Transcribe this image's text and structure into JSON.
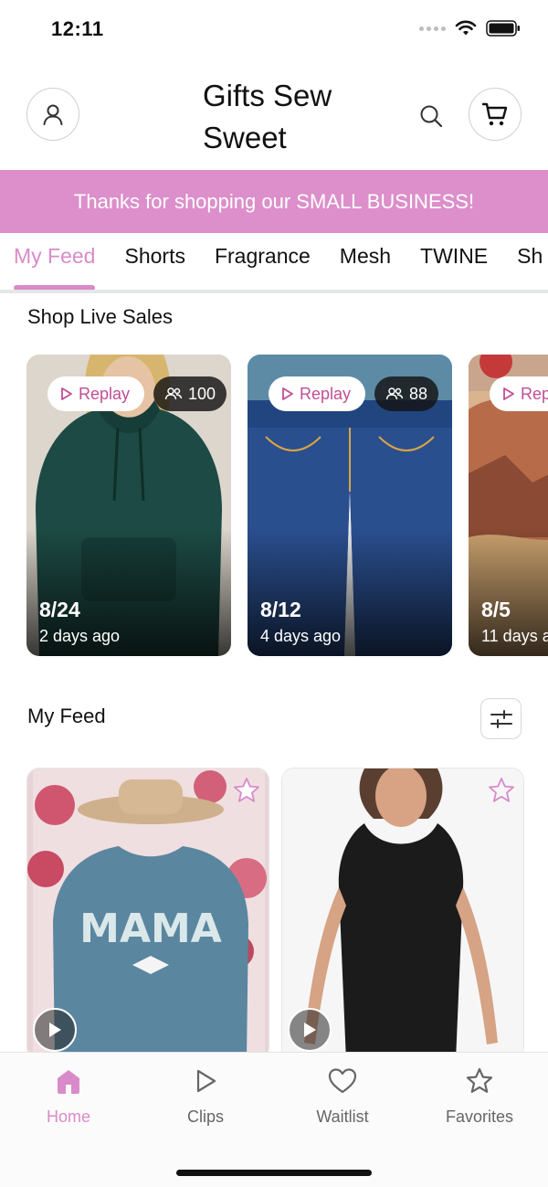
{
  "status_bar": {
    "time": "12:11"
  },
  "header": {
    "title": "Gifts Sew Sweet"
  },
  "banner": {
    "text": "Thanks for shopping our SMALL BUSINESS!"
  },
  "tabs": [
    {
      "label": "My Feed",
      "active": true
    },
    {
      "label": "Shorts"
    },
    {
      "label": "Fragrance"
    },
    {
      "label": "Mesh"
    },
    {
      "label": "TWINE"
    },
    {
      "label": "Sh"
    }
  ],
  "live_section": {
    "title": "Shop Live Sales",
    "cards": [
      {
        "replay_label": "Replay",
        "viewers": "100",
        "date": "8/24",
        "ago": "2 days ago"
      },
      {
        "replay_label": "Replay",
        "viewers": "88",
        "date": "8/12",
        "ago": "4 days ago"
      },
      {
        "replay_label": "Rep",
        "date": "8/5",
        "ago": "11 days ag"
      }
    ]
  },
  "feed_section": {
    "title": "My Feed"
  },
  "bottom_nav": [
    {
      "label": "Home",
      "icon": "home-icon",
      "active": true
    },
    {
      "label": "Clips",
      "icon": "play-outline-icon"
    },
    {
      "label": "Waitlist",
      "icon": "heart-icon"
    },
    {
      "label": "Favorites",
      "icon": "star-icon"
    }
  ],
  "colors": {
    "brand": "#d98ac9",
    "banner": "#dc8fca",
    "replay_text": "#c14e95"
  }
}
